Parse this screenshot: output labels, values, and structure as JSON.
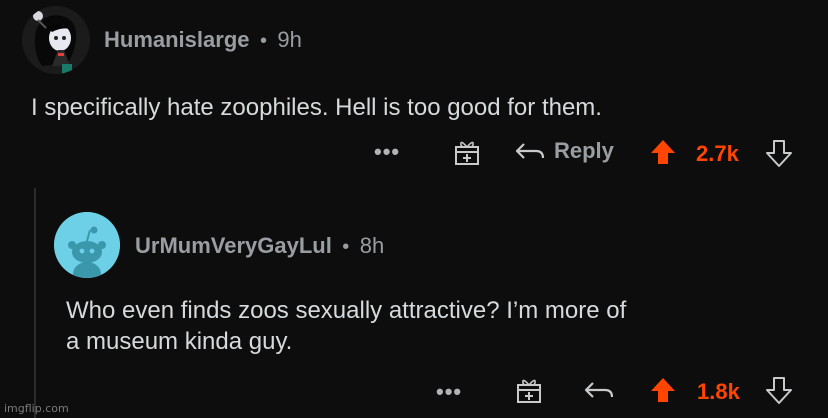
{
  "comment1": {
    "username": "Humanislarge",
    "separator": "•",
    "age": "9h",
    "text": "I specifically hate zoophiles. Hell is too good for them.",
    "actions": {
      "more": "•••",
      "reply_label": "Reply",
      "votes": "2.7k"
    }
  },
  "comment2": {
    "username": "UrMumVeryGayLul",
    "separator": "•",
    "age": "8h",
    "text_line1": "Who even finds zoos sexually attractive? I’m more of",
    "text_line2": "a museum kinda guy.",
    "actions": {
      "more": "•••",
      "votes": "1.8k"
    }
  },
  "watermark": "imgflip.com",
  "colors": {
    "background": "#0d0d0d",
    "upvote_active": "#ff4500",
    "muted": "#9a9ea2",
    "text": "#d7dadc"
  }
}
